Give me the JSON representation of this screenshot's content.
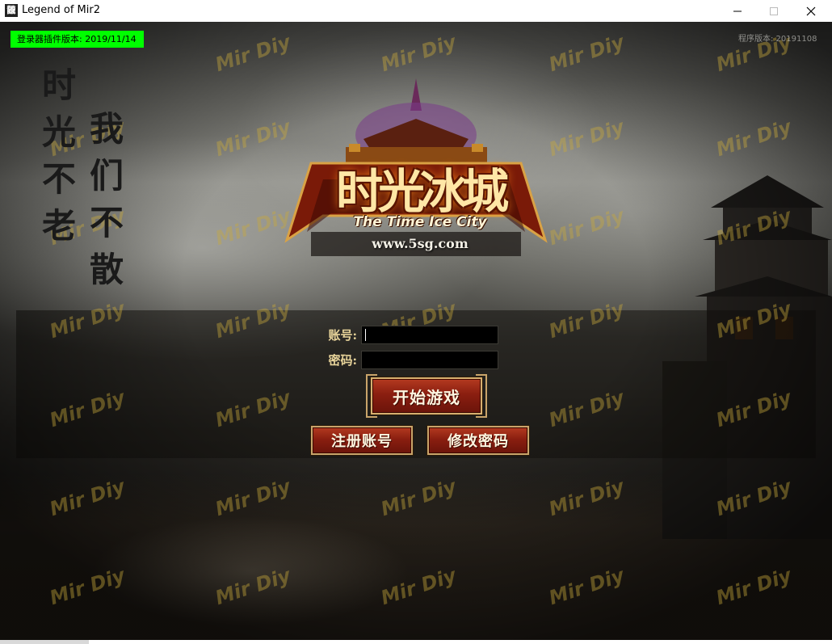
{
  "window": {
    "title": "Legend of Mir2",
    "icon_glyph": "龖",
    "controls": {
      "minimize": "minimize-icon",
      "maximize": "maximize-icon",
      "close": "close-icon"
    }
  },
  "overlay": {
    "plugin_version": "登录器插件版本: 2019/11/14",
    "client_version": "程序版本: 20191108"
  },
  "calligraphy": {
    "right_column": "时光不老",
    "left_column": "我们不散"
  },
  "logo": {
    "title": "时光冰城",
    "subtitle": "The Time Ice City",
    "url": "www.5sg.com"
  },
  "login": {
    "account_label": "账号:",
    "password_label": "密码:",
    "account_value": "",
    "password_value": "",
    "start_button": "开始游戏",
    "register_button": "注册账号",
    "change_password_button": "修改密码"
  },
  "watermark_text": "Mir Diy",
  "colors": {
    "accent_green": "#00ff00",
    "button_red": "#8a1e10",
    "button_border_gold": "#c9a46a",
    "label_gold": "#e8d49a",
    "watermark": "#c8aa3c"
  }
}
